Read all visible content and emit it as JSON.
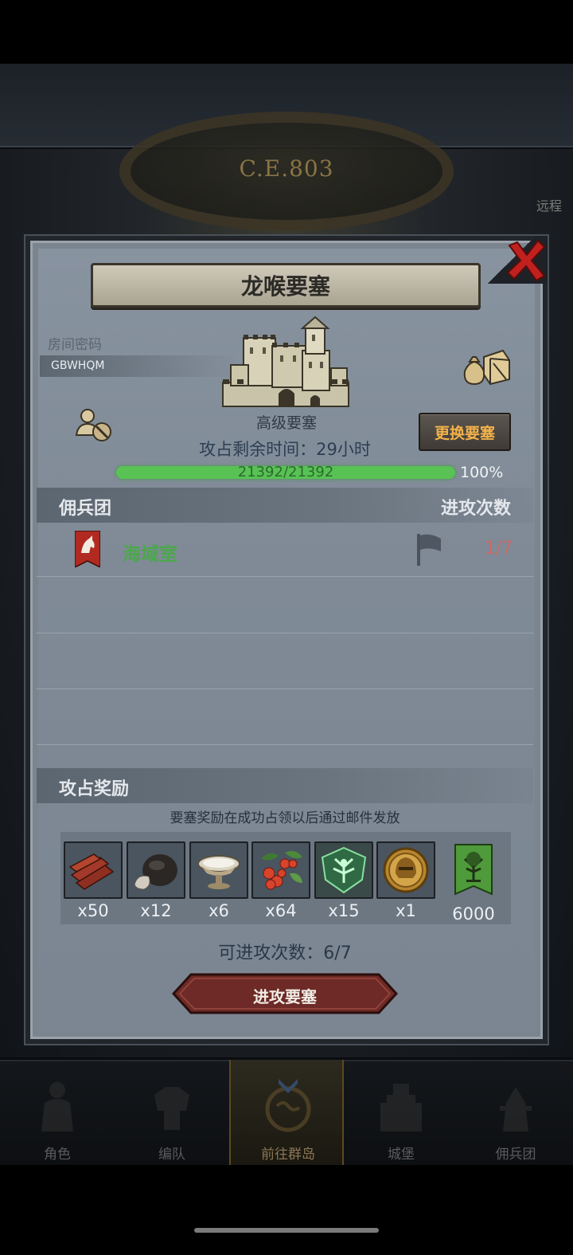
{
  "background": {
    "era_text": "C.E.803",
    "side_label": "远程"
  },
  "popup": {
    "title": "龙喉要塞",
    "room_password_label": "房间密码",
    "room_password": "GBWHQM",
    "fort_type": "高级要塞",
    "time_remaining": "攻占剩余时间：29小时",
    "change_fort_button": "更换要塞",
    "hp": {
      "text": "21392/21392",
      "current": 21392,
      "max": 21392,
      "percent_text": "100%"
    },
    "mercenary_section": {
      "title": "佣兵团",
      "count_header": "进攻次数"
    },
    "mercenaries": [
      {
        "name": "海域室",
        "attacks": "1/7"
      }
    ],
    "reward_section": {
      "title": "攻占奖励",
      "note": "要塞奖励在成功占领以后通过邮件发放",
      "items": [
        {
          "icon": "wood-icon",
          "qty": "x50"
        },
        {
          "icon": "truffle-icon",
          "qty": "x12"
        },
        {
          "icon": "bowl-icon",
          "qty": "x6"
        },
        {
          "icon": "berries-icon",
          "qty": "x64"
        },
        {
          "icon": "tree-emblem-icon",
          "qty": "x15"
        },
        {
          "icon": "helmet-coin-icon",
          "qty": "x1"
        },
        {
          "icon": "green-banner-icon",
          "qty": "6000"
        }
      ]
    },
    "attacks_left": "可进攻次数：6/7",
    "attack_button": "进攻要塞"
  },
  "nav": [
    {
      "label": "角色",
      "icon": "knight-icon"
    },
    {
      "label": "编队",
      "icon": "armor-icon"
    },
    {
      "label": "前往群岛",
      "icon": "world-icon",
      "active": true
    },
    {
      "label": "城堡",
      "icon": "castle-icon"
    },
    {
      "label": "佣兵团",
      "icon": "mercenary-icon"
    }
  ],
  "colors": {
    "accent_orange": "#f2b24a",
    "hp_green": "#58c255",
    "merc_green": "#4ba84b",
    "attack_red": "#c86a6a",
    "button_red": "#6e2a26"
  }
}
